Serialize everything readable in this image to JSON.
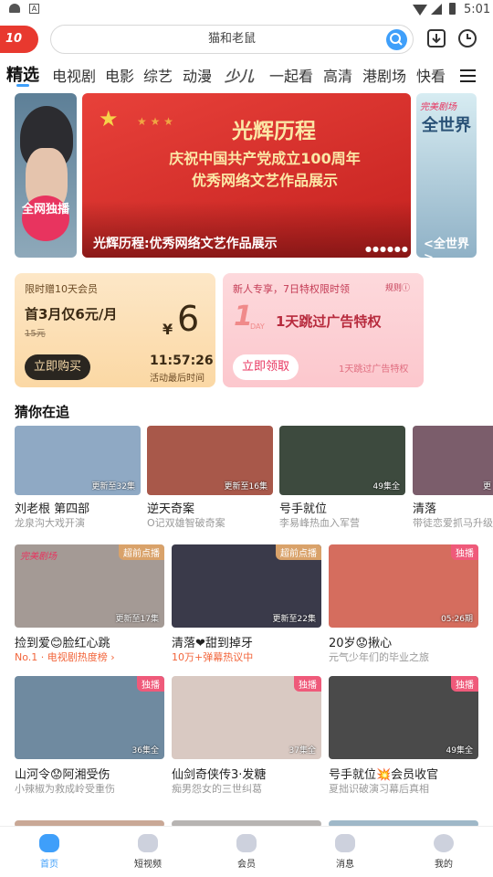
{
  "status": {
    "time": "5:01"
  },
  "header": {
    "logo": "10",
    "search_placeholder": "猫和老鼠"
  },
  "nav": {
    "tabs": [
      "精选",
      "电视剧",
      "电影",
      "综艺",
      "动漫",
      "少儿",
      "一起看",
      "高清",
      "港剧场",
      "快看"
    ]
  },
  "banner": {
    "left_badge": "全网独播",
    "main_title": "光辉历程",
    "main_line1": "庆祝中国共产党成立100周年",
    "main_line2": "优秀网络文艺作品展示",
    "main_caption": "光辉历程:优秀网络文艺作品展示",
    "right_logo": "完美剧场",
    "right_title": "全世界",
    "right_caption": "<全世界>"
  },
  "promo_left": {
    "tag": "限时赠10天会员",
    "offer": "首3月仅6元/月",
    "old_price": "15元",
    "currency": "¥",
    "price": "6",
    "button": "立即购买",
    "countdown": "11:57:26",
    "countdown_label": "活动最后时间"
  },
  "promo_right": {
    "tag": "新人专享，7日特权限时领",
    "rules": "规则ⓘ",
    "day_icon": "1",
    "day_text": "DAY",
    "title": "1天跳过广告特权",
    "button": "立即领取",
    "subtitle": "1天跳过广告特权"
  },
  "section": {
    "title": "猜你在追"
  },
  "follow": [
    {
      "title": "刘老根 第四部",
      "sub": "龙泉沟大戏开演",
      "ep": "更新至32集",
      "bg": "#8fa9c4"
    },
    {
      "title": "逆天奇案",
      "sub": "O记双雄智破奇案",
      "ep": "更新至16集",
      "bg": "#a8584a"
    },
    {
      "title": "号手就位",
      "sub": "李易峰热血入军营",
      "ep": "49集全",
      "bg": "#3d4a3e"
    },
    {
      "title": "清落",
      "sub": "带徒恋爱抓马升级",
      "ep": "更",
      "bg": "#7b5d6b"
    }
  ],
  "grid": [
    {
      "title": "捡到爱😊脸红心跳",
      "sub": "No.1 · 电视剧热度榜 ›",
      "sub_color": "#f2653b",
      "badge": "超前点播",
      "badge_color": "#d9a26a",
      "ep": "更新至17集",
      "logo": "完美剧场",
      "bg": "#a49a95"
    },
    {
      "title": "清落❤甜到掉牙",
      "sub": "10万+弹幕热议中",
      "sub_color": "#f2653b",
      "badge": "超前点播",
      "badge_color": "#d9a26a",
      "ep": "更新至22集",
      "logo": "",
      "bg": "#3a3a4a"
    },
    {
      "title": "20岁😟揪心",
      "sub": "元气少年们的毕业之旅",
      "sub_color": "#999",
      "badge": "独播",
      "badge_color": "#ef5a7a",
      "ep": "05:26期",
      "logo": "",
      "bg": "#d56d5e"
    },
    {
      "title": "山河令😟阿湘受伤",
      "sub": "小辣椒为救成岭受重伤",
      "sub_color": "#999",
      "badge": "独播",
      "badge_color": "#ef5a7a",
      "ep": "36集全",
      "logo": "",
      "bg": "#6f8aa0"
    },
    {
      "title": "仙剑奇侠传3·发糖",
      "sub": "痴男怨女的三世纠葛",
      "sub_color": "#999",
      "badge": "独播",
      "badge_color": "#ef5a7a",
      "ep": "37集全",
      "logo": "",
      "bg": "#d9c9c2"
    },
    {
      "title": "号手就位💥会员收官",
      "sub": "夏拙识破演习幕后真相",
      "sub_color": "#999",
      "badge": "独播",
      "badge_color": "#ef5a7a",
      "ep": "49集全",
      "logo": "",
      "bg": "#4a4a4a"
    }
  ],
  "tabbar": [
    {
      "label": "首页",
      "color": "#3f9ffa"
    },
    {
      "label": "短视频",
      "color": "#333"
    },
    {
      "label": "会员",
      "color": "#333"
    },
    {
      "label": "消息",
      "color": "#333"
    },
    {
      "label": "我的",
      "color": "#333"
    }
  ]
}
